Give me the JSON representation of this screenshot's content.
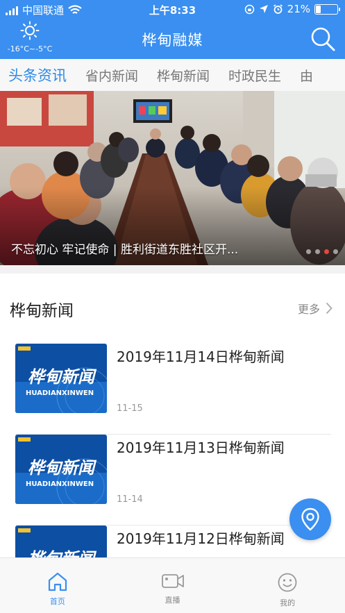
{
  "status_bar": {
    "carrier": "中国联通",
    "time": "上午8:33",
    "battery": "21%",
    "battery_level": 0.21
  },
  "header": {
    "weather_icon": "sun-icon",
    "temperature": "-16°C~-5°C",
    "title": "桦甸融媒",
    "search_icon": "search-icon"
  },
  "tabs": [
    {
      "label": "头条资讯",
      "active": true
    },
    {
      "label": "省内新闻",
      "active": false
    },
    {
      "label": "桦甸新闻",
      "active": false
    },
    {
      "label": "时政民生",
      "active": false
    },
    {
      "label": "由",
      "active": false
    }
  ],
  "banner": {
    "caption": "不忘初心 牢记使命 | 胜利街道东胜社区开...",
    "dot_count": 4,
    "active_dot": 3
  },
  "section": {
    "title": "桦甸新闻",
    "more_label": "更多"
  },
  "thumb_text": {
    "main": "桦甸新闻",
    "sub": "HUADIANXINWEN"
  },
  "news": [
    {
      "title": "2019年11月14日桦甸新闻",
      "date": "11-15"
    },
    {
      "title": "2019年11月13日桦甸新闻",
      "date": "11-14"
    },
    {
      "title": "2019年11月12日桦甸新闻",
      "date": ""
    }
  ],
  "bottom_nav": [
    {
      "label": "首页",
      "icon": "home-icon",
      "active": true
    },
    {
      "label": "直播",
      "icon": "video-camera-icon",
      "active": false
    },
    {
      "label": "我的",
      "icon": "smiley-face-icon",
      "active": false
    }
  ],
  "colors": {
    "brand_blue": "#3a8ff0",
    "active_tab": "#2e8ae6",
    "active_dot": "#e8453c"
  }
}
